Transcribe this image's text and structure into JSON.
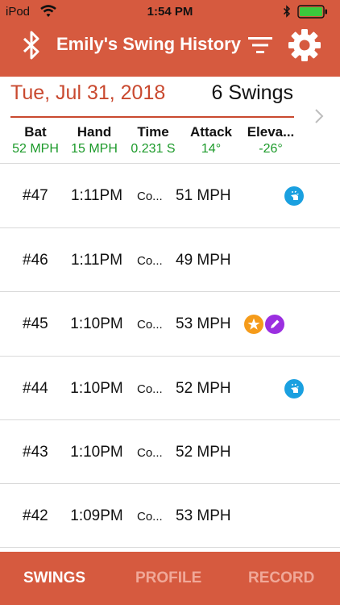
{
  "status_bar": {
    "carrier": "iPod",
    "time": "1:54 PM"
  },
  "nav": {
    "title": "Emily's Swing History"
  },
  "summary": {
    "date": "Tue, Jul 31, 2018",
    "count": "6 Swings"
  },
  "stats": [
    {
      "label": "Bat",
      "value": "52 MPH"
    },
    {
      "label": "Hand",
      "value": "15 MPH"
    },
    {
      "label": "Time",
      "value": "0.231 S"
    },
    {
      "label": "Attack",
      "value": "14°"
    },
    {
      "label": "Eleva...",
      "value": "-26°"
    }
  ],
  "swings": [
    {
      "number": "#47",
      "time": "1:11PM",
      "type": "Co...",
      "speed": "51 MPH",
      "badges": [
        "tap-icon"
      ]
    },
    {
      "number": "#46",
      "time": "1:11PM",
      "type": "Co...",
      "speed": "49 MPH",
      "badges": []
    },
    {
      "number": "#45",
      "time": "1:10PM",
      "type": "Co...",
      "speed": "53 MPH",
      "badges": [
        "star-icon",
        "pencil-icon"
      ]
    },
    {
      "number": "#44",
      "time": "1:10PM",
      "type": "Co...",
      "speed": "52 MPH",
      "badges": [
        "tap-icon"
      ]
    },
    {
      "number": "#43",
      "time": "1:10PM",
      "type": "Co...",
      "speed": "52 MPH",
      "badges": []
    },
    {
      "number": "#42",
      "time": "1:09PM",
      "type": "Co...",
      "speed": "53 MPH",
      "badges": []
    }
  ],
  "tabs": [
    {
      "label": "SWINGS",
      "active": true
    },
    {
      "label": "PROFILE",
      "active": false
    },
    {
      "label": "RECORD",
      "active": false
    }
  ],
  "colors": {
    "brand": "#d65a3f",
    "date_text": "#c9492f",
    "stat_value": "#1c9a2a",
    "tap_badge": "#1aa0e0",
    "star_badge": "#f59b1a",
    "pencil_badge": "#9b2fe0",
    "tab_active": "#ffffff",
    "tab_inactive": "#f0a898"
  }
}
